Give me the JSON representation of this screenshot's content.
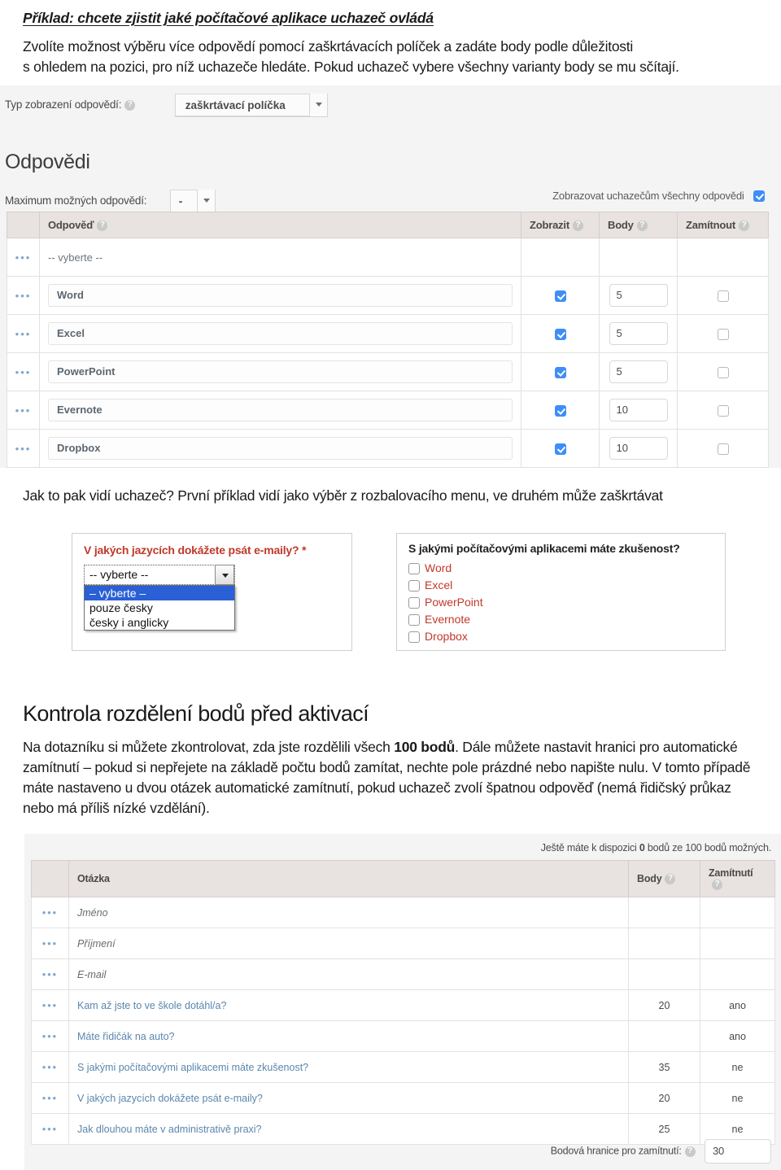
{
  "doc": {
    "heading": "Příklad: chcete zjistit jaké počítačové aplikace uchazeč ovládá",
    "intro_line1": "Zvolíte možnost výběru více odpovědí pomocí zaškrtávacích políček a zadáte body podle důležitosti",
    "intro_line2": "s ohledem na pozici, pro níž uchazeče hledáte. Pokud uchazeč vybere všechny varianty body se mu sčítají.",
    "mid_text": "Jak to pak vidí uchazeč? První příklad vidí jako výběr z rozbalovacího menu, ve druhém může zaškrtávat",
    "section_heading": "Kontrola rozdělení bodů před aktivací",
    "section_para_1": "Na dotazníku si můžete zkontrolovat, zda jste rozdělili všech ",
    "section_para_bold": "100 bodů",
    "section_para_2": ". Dále můžete nastavit hranici pro automatické zamítnutí – pokud si nepřejete na základě počtu bodů zamítat, nechte pole prázdné nebo napište nulu. V tomto případě máte nastaveno u dvou otázek automatické zamítnutí, pokud uchazeč zvolí špatnou odpověď (nemá řidičský průkaz nebo má příliš nízké vzdělání)."
  },
  "editor": {
    "type_label": "Typ zobrazení odpovědí:",
    "type_value": "zaškrtávací políčka",
    "answers_heading": "Odpovědi",
    "max_label": "Maximum možných odpovědí:",
    "max_value": "-",
    "show_all_label": "Zobrazovat uchazečům všechny odpovědi",
    "show_all_checked": true,
    "columns": [
      "Odpověď",
      "Zobrazit",
      "Body",
      "Zamítnout"
    ],
    "handle_glyph": "•••",
    "rows": [
      {
        "answer": "-- vyberte --",
        "is_placeholder": true,
        "show": null,
        "points": "",
        "reject": null
      },
      {
        "answer": "Word",
        "is_placeholder": false,
        "show": true,
        "points": "5",
        "reject": false
      },
      {
        "answer": "Excel",
        "is_placeholder": false,
        "show": true,
        "points": "5",
        "reject": false
      },
      {
        "answer": "PowerPoint",
        "is_placeholder": false,
        "show": true,
        "points": "5",
        "reject": false
      },
      {
        "answer": "Evernote",
        "is_placeholder": false,
        "show": true,
        "points": "10",
        "reject": false
      },
      {
        "answer": "Dropbox",
        "is_placeholder": false,
        "show": true,
        "points": "10",
        "reject": false
      }
    ]
  },
  "preview_select": {
    "question": "V jakých jazycích dokážete psát e-maily? *",
    "selected": "-- vyberte --",
    "options": [
      "– vyberte –",
      "pouze česky",
      "česky i anglicky"
    ],
    "highlighted_index": 0,
    "accent": "#c0392b"
  },
  "preview_checkbox": {
    "question": "S jakými počítačovými aplikacemi máte zkušenost?",
    "options": [
      "Word",
      "Excel",
      "PowerPoint",
      "Evernote",
      "Dropbox"
    ],
    "accent": "#c0392b"
  },
  "overview": {
    "available_prefix": "Ještě máte k dispozici ",
    "available_value": "0",
    "available_suffix": " bodů ze 100 bodů možných.",
    "columns": [
      "Otázka",
      "Body",
      "Zamítnutí"
    ],
    "handle_glyph": "•••",
    "rows": [
      {
        "question": "Jméno",
        "system": true,
        "points": "",
        "reject": ""
      },
      {
        "question": "Příjmení",
        "system": true,
        "points": "",
        "reject": ""
      },
      {
        "question": "E-mail",
        "system": true,
        "points": "",
        "reject": ""
      },
      {
        "question": "Kam až jste to ve škole dotáhl/a?",
        "system": false,
        "points": "20",
        "reject": "ano"
      },
      {
        "question": "Máte řidičák na auto?",
        "system": false,
        "points": "",
        "reject": "ano"
      },
      {
        "question": "S jakými počítačovými aplikacemi máte zkušenost?",
        "system": false,
        "points": "35",
        "reject": "ne"
      },
      {
        "question": "V jakých jazycích dokážete psát e-maily?",
        "system": false,
        "points": "20",
        "reject": "ne"
      },
      {
        "question": "Jak dlouhou máte v administrativě praxi?",
        "system": false,
        "points": "25",
        "reject": "ne"
      }
    ],
    "threshold_label": "Bodová hranice pro zamítnutí:",
    "threshold_value": "30"
  }
}
